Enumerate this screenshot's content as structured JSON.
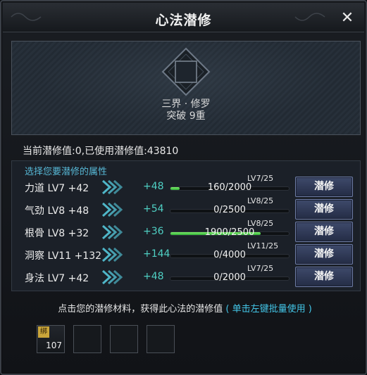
{
  "window": {
    "title": "心法潜修",
    "close_glyph": "✕"
  },
  "hero": {
    "name": "三界 · 修罗",
    "stage": "突破 9重"
  },
  "status": {
    "text": "当前潜修值:0,已使用潜修值:43810"
  },
  "select_label": "选择您要潜修的属性",
  "attributes": [
    {
      "name": "力道",
      "level": "LV7",
      "bonus": "+42",
      "add": "+48",
      "lv_cap": "LV7/25",
      "progress": "160/2000",
      "fraction": 0.08
    },
    {
      "name": "气劲",
      "level": "LV8",
      "bonus": "+48",
      "add": "+54",
      "lv_cap": "LV8/25",
      "progress": "0/2500",
      "fraction": 0.0
    },
    {
      "name": "根骨",
      "level": "LV8",
      "bonus": "+32",
      "add": "+36",
      "lv_cap": "LV8/25",
      "progress": "1900/2500",
      "fraction": 0.76
    },
    {
      "name": "洞察",
      "level": "LV11",
      "bonus": "+132",
      "add": "+144",
      "lv_cap": "LV11/25",
      "progress": "0/4000",
      "fraction": 0.0
    },
    {
      "name": "身法",
      "level": "LV7",
      "bonus": "+42",
      "add": "+48",
      "lv_cap": "LV7/25",
      "progress": "0/2000",
      "fraction": 0.0
    }
  ],
  "buttons": {
    "cultivate": "潜修"
  },
  "hint": {
    "main": "点击您的潜修材料，获得此心法的潜修值",
    "action": "( 单击左键批量使用 )"
  },
  "slots": [
    {
      "tag": "绑",
      "count": "107"
    },
    {
      "tag": "",
      "count": ""
    },
    {
      "tag": "",
      "count": ""
    },
    {
      "tag": "",
      "count": ""
    }
  ],
  "colors": {
    "accent_cyan": "#43c6e8",
    "bonus_teal": "#4fd0c4",
    "bar_green": "#4fd24a",
    "button_blue": "#2c3652"
  }
}
